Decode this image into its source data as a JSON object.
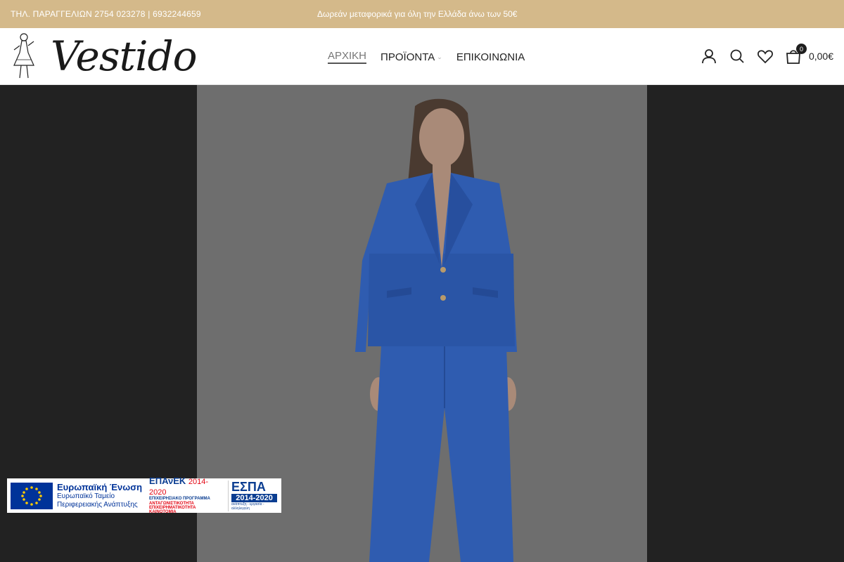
{
  "topbar": {
    "phone": "ΤΗΛ. ΠΑΡΑΓΓΕΛΙΩΝ 2754 023278 | 6932244659",
    "promo": "Δωρεάν μεταφορικά για όλη την Ελλάδα άνω των 50€"
  },
  "brand": {
    "name": "Vestido"
  },
  "nav": {
    "items": [
      {
        "label": "ΑΡΧΙΚΗ"
      },
      {
        "label": "ΠΡΟΪΟΝΤΑ"
      },
      {
        "label": "ΕΠΙΚΟΙΝΩΝΙΑ"
      }
    ]
  },
  "icons": [
    "user-icon",
    "search-icon",
    "heart-icon",
    "cart-icon"
  ],
  "cart": {
    "count": "0",
    "total": "0,00€"
  },
  "eu_banner": {
    "eu_title": "Ευρωπαϊκή Ένωση",
    "eu_sub1": "Ευρωπαϊκό Ταμείο",
    "eu_sub2": "Περιφερειακής Ανάπτυξης",
    "epanek_title": "ΕΠΑνΕΚ",
    "epanek_years": "2014-2020",
    "epanek_line1": "ΕΠΙΧΕΙΡΗΣΙΑΚΟ ΠΡΟΓΡΑΜΜΑ",
    "epanek_line2": "ΑΝΤΑΓΩΝΙΣΤΙΚΟΤΗΤΑ",
    "epanek_line3": "ΕΠΙΧΕΙΡΗΜΑΤΙΚΟΤΗΤΑ",
    "epanek_line4": "ΚΑΙΝΟΤΟΜΙΑ",
    "espa_title": "ΕΣΠΑ",
    "espa_years": "2014-2020",
    "espa_tagline": "ανάπτυξη - εργασία - αλληλεγγύη"
  },
  "colors": {
    "topbar": "#d4b98a",
    "overlay": "#222222",
    "suit": "#2f5cb0"
  }
}
